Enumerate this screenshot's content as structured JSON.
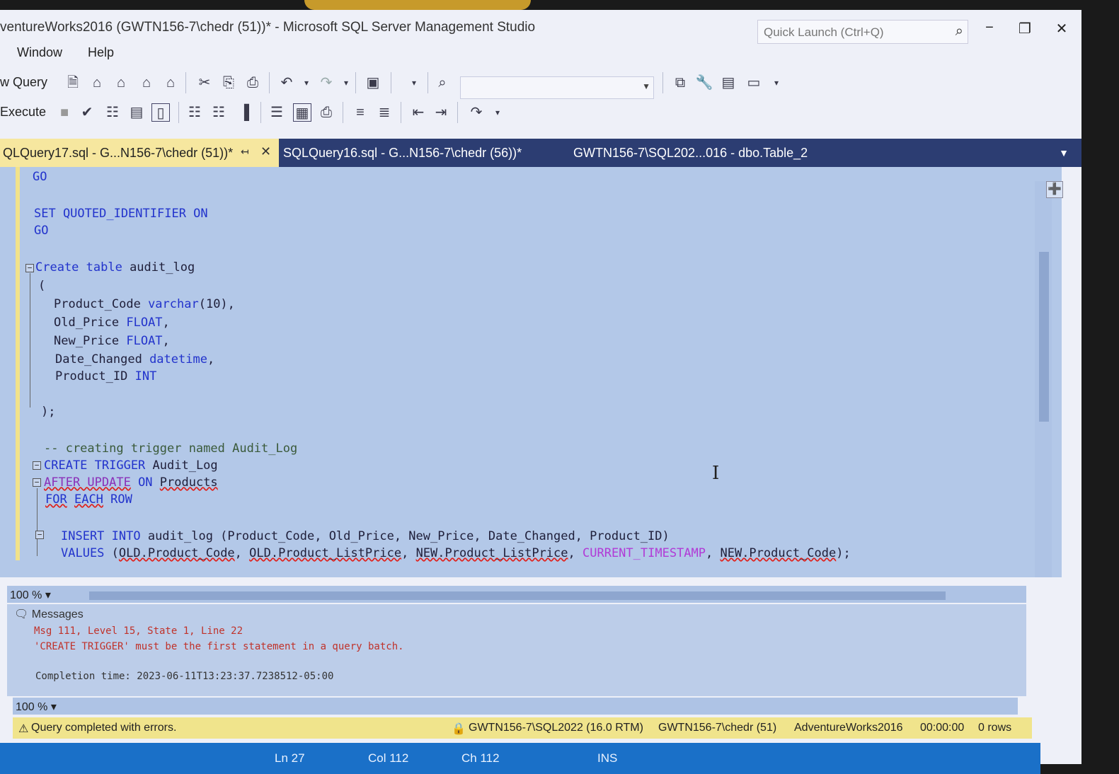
{
  "window": {
    "title": "ventureWorks2016 (GWTN156-7\\chedr (51))* - Microsoft SQL Server Management Studio",
    "quick_launch_placeholder": "Quick Launch (Ctrl+Q)",
    "minimize": "−",
    "restore": "❐",
    "close": "✕"
  },
  "menu": {
    "items": [
      "Window",
      "Help"
    ]
  },
  "toolbar": {
    "new_query_label": "w Query",
    "execute_label": "Execute",
    "database_combo_value": ""
  },
  "tabs": [
    {
      "label": "QLQuery17.sql - G...N156-7\\chedr (51))*",
      "active": true
    },
    {
      "label": "SQLQuery16.sql - G...N156-7\\chedr (56))*",
      "active": false
    },
    {
      "label": "GWTN156-7\\SQL202...016 - dbo.Table_2",
      "active": false
    }
  ],
  "editor": {
    "lines": {
      "l1": "GO",
      "l2": "SET QUOTED_IDENTIFIER ON",
      "l3": "GO",
      "l4a": "Create table",
      "l4b": " audit_log",
      "l5": "(",
      "l6a": "Product_Code ",
      "l6b": "varchar",
      "l6c": "(10),",
      "l7a": "Old_Price ",
      "l7b": "FLOAT",
      "l7c": ",",
      "l8a": "New_Price ",
      "l8b": "FLOAT",
      "l8c": ",",
      "l9a": "Date_Changed ",
      "l9b": "datetime",
      "l9c": ",",
      "l10a": "Product_ID ",
      "l10b": "INT",
      "l11": ");",
      "l12": "-- creating trigger named Audit_Log",
      "l13a": "CREATE TRIGGER",
      "l13b": " Audit_Log",
      "l14a": "AFTER UPDATE",
      "l14b": " ON ",
      "l14c": "Products",
      "l15a": "FOR",
      "l15b": "EACH",
      "l15c": "ROW",
      "l16a": "INSERT INTO",
      "l16b": " audit_log (Product_Code, Old_Price, New_Price, Date_Changed, Product_ID)",
      "l17a": "VALUES",
      "l17b": " (",
      "l17c": "OLD.Product_Code",
      "l17d": ", ",
      "l17e": "OLD.Product_ListPrice",
      "l17f": ", ",
      "l17g": "NEW.Product_ListPrice",
      "l17h": ", ",
      "l17i": "CURRENT_TIMESTAMP",
      "l17j": ", ",
      "l17k": "NEW.Product_Code",
      "l17l": ");"
    },
    "zoom": "100 %"
  },
  "messages": {
    "header": "Messages",
    "lines": [
      "Msg 111, Level 15, State 1, Line 22",
      "'CREATE TRIGGER' must be the first statement in a query batch.",
      "Completion time: 2023-06-11T13:23:37.7238512-05:00"
    ],
    "zoom": "100 %"
  },
  "query_status": {
    "message": "Query completed with errors.",
    "server": "GWTN156-7\\SQL2022 (16.0 RTM)",
    "user": "GWTN156-7\\chedr (51)",
    "database": "AdventureWorks2016",
    "elapsed": "00:00:00",
    "rows": "0 rows"
  },
  "statusbar": {
    "ln": "Ln 27",
    "col": "Col 112",
    "ch": "Ch 112",
    "mode": "INS"
  },
  "colors": {
    "tab_active": "#f6e79f",
    "tab_strip": "#2c3d72",
    "statusbar": "#1a70c8",
    "editor_bg": "#b3c8e8"
  }
}
